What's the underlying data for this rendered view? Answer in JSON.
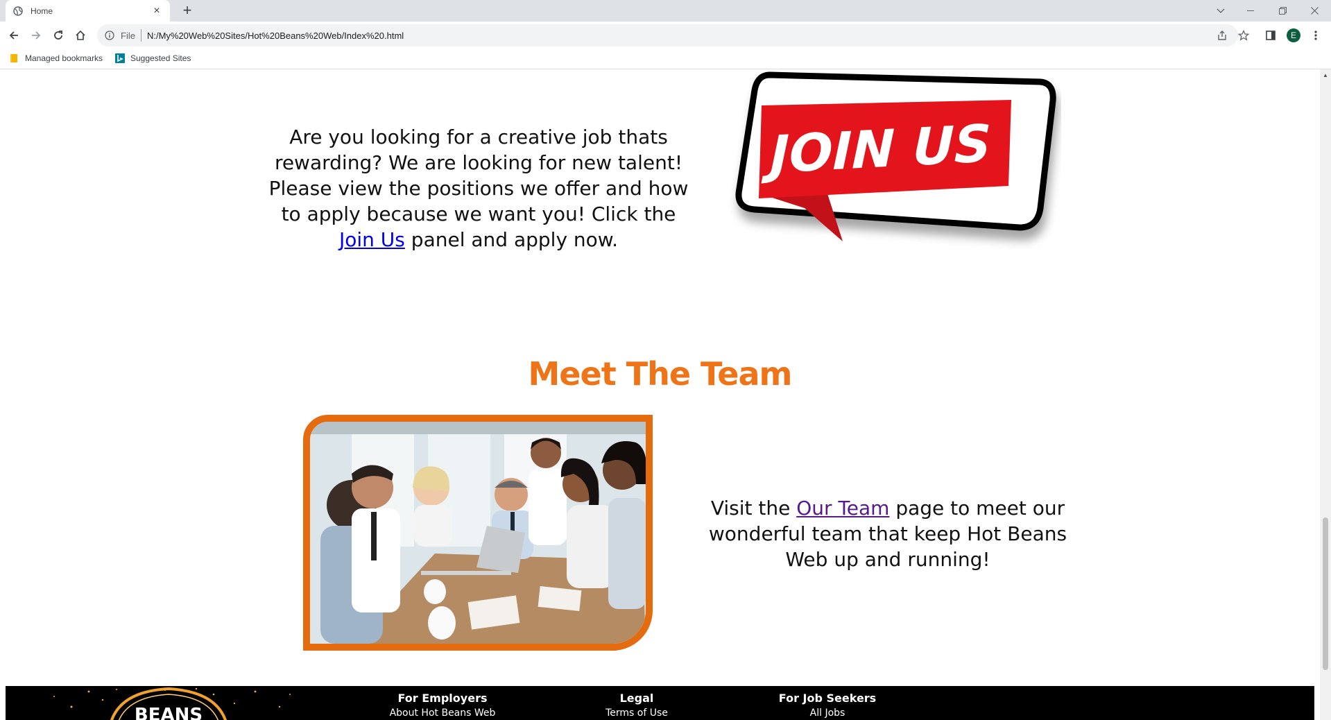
{
  "browser": {
    "tab_title": "Home",
    "tab_close": "×",
    "new_tab": "+",
    "omnibox_file_label": "File",
    "url": "N:/My%20Web%20Sites/Hot%20Beans%20Web/Index%20.html",
    "profile_initial": "E",
    "bookmarks": [
      {
        "label": "Managed bookmarks",
        "icon": "folder-icon"
      },
      {
        "label": "Suggested Sites",
        "icon": "bing-icon"
      }
    ]
  },
  "join_section": {
    "text_before_link": "Are you looking for a creative job thats rewarding? We are looking for new talent! Please view the positions we offer and how to apply because we want you! Click the ",
    "link_label": "Join Us",
    "text_after_link": " panel and apply now.",
    "banner_text": "JOIN US"
  },
  "team_section": {
    "heading": "Meet The Team",
    "text_before_link": "Visit the ",
    "link_label": "Our Team",
    "text_after_link": " page to meet our wonderful team that keep Hot Beans Web up and running!"
  },
  "footer": {
    "logo_text": "BEANS",
    "columns": [
      {
        "heading": "For Employers",
        "link": "About Hot Beans Web"
      },
      {
        "heading": "Legal",
        "link": "Terms of Use"
      },
      {
        "heading": "For Job Seekers",
        "link": "All Jobs"
      }
    ]
  },
  "colors": {
    "accent_orange": "#ee7417",
    "photo_border": "#e46c0f",
    "banner_red": "#e3141b",
    "link_blue": "#0000ee",
    "link_visited": "#551a8b",
    "footer_bg": "#000000"
  }
}
